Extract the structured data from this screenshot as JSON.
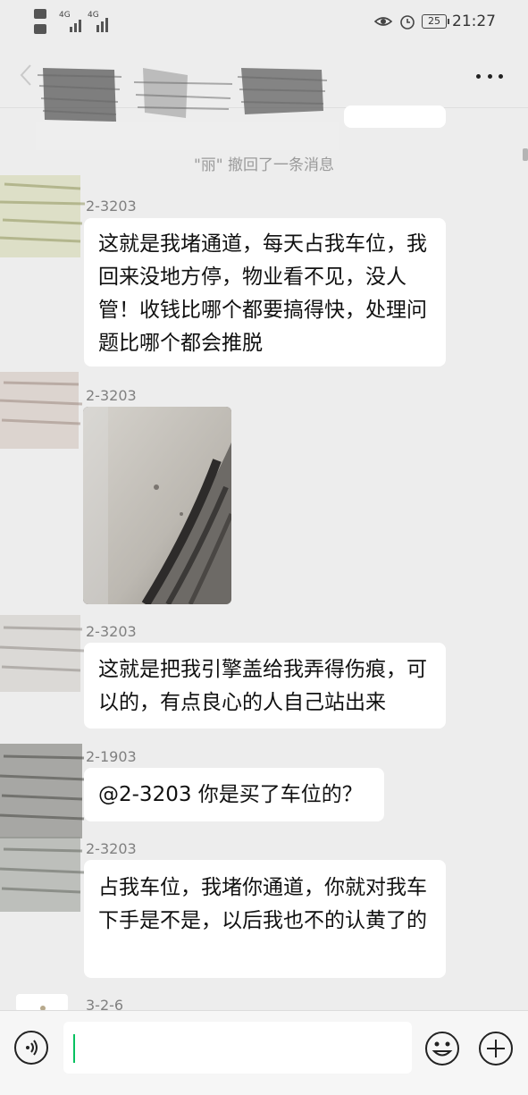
{
  "status_bar": {
    "network_left_top": "4G",
    "network_left_bottom": "4G",
    "battery": "25",
    "time": "21:27"
  },
  "system_notice": "\"丽\" 撤回了一条消息",
  "messages": [
    {
      "sender": "2-3203",
      "text": "这就是我堵通道，每天占我车位，我回来没地方停，物业看不见，没人管！收钱比哪个都要搞得快，处理问题比哪个都会推脱"
    },
    {
      "sender": "2-3203",
      "type": "image"
    },
    {
      "sender": "2-3203",
      "text": "这就是把我引擎盖给我弄得伤痕，可以的，有点良心的人自己站出来"
    },
    {
      "sender": "2-1903",
      "text": "@2-3203  你是买了车位的？"
    },
    {
      "sender": "2-3203",
      "text": "占我车位，我堵你通道，你就对我车下手是不是，以后我也不的认黄了的"
    },
    {
      "sender": "3-2-6"
    }
  ],
  "icons": {
    "back": "chevron-left-icon",
    "more": "more-dots-icon",
    "voice": "voice-icon",
    "emoji": "emoji-icon",
    "plus": "plus-icon"
  },
  "colors": {
    "background": "#ededed",
    "bubble": "#ffffff",
    "caret": "#07c160"
  }
}
